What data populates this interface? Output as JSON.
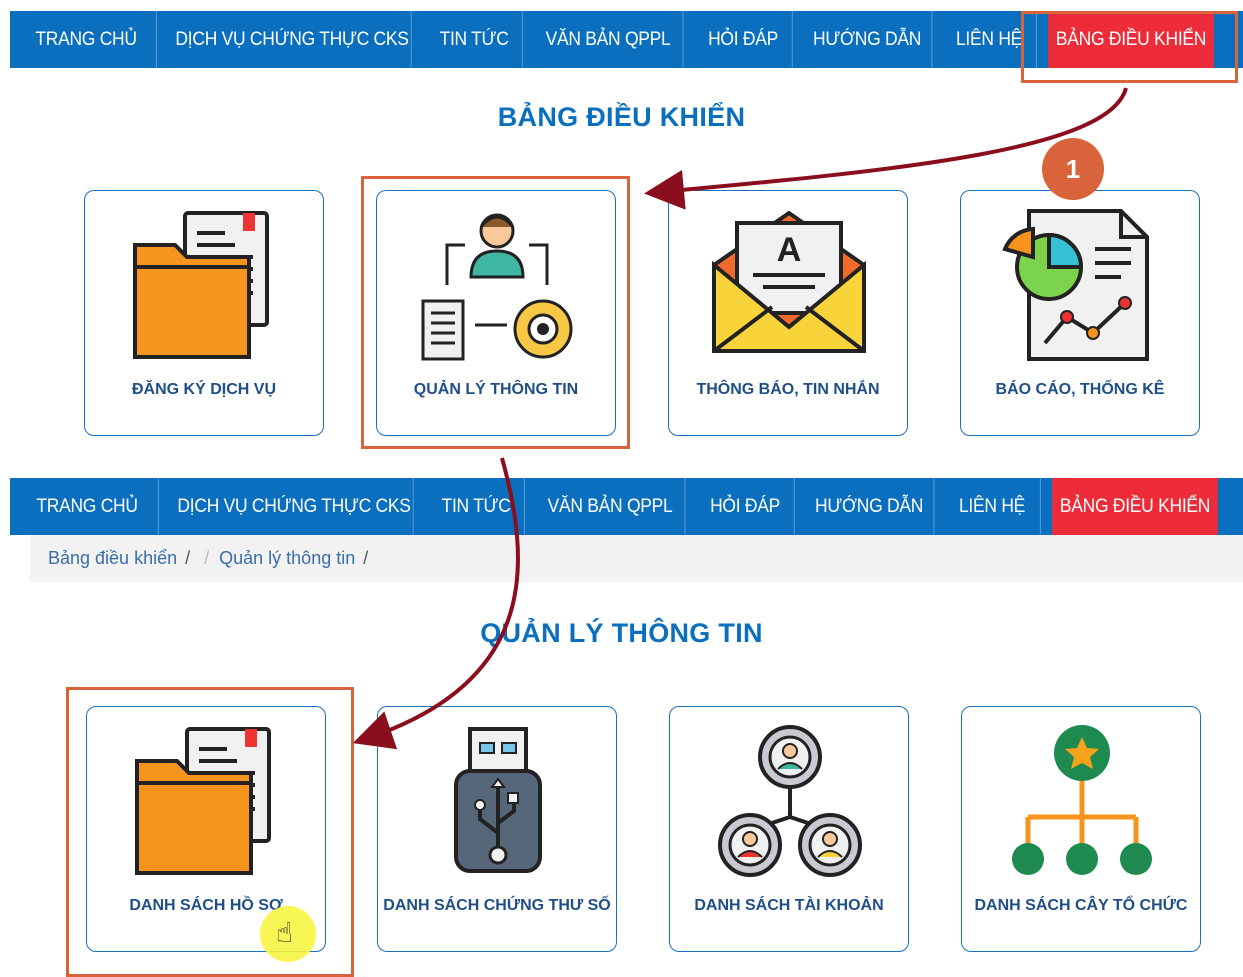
{
  "nav": {
    "items": [
      "TRANG CHỦ",
      "DỊCH VỤ CHỨNG THỰC CKS",
      "TIN TỨC",
      "VĂN BẢN QPPL",
      "HỎI ĐÁP",
      "HƯỚNG DẪN",
      "LIÊN HỆ",
      "BẢNG ĐIỀU KHIỂN"
    ],
    "active_index": 7
  },
  "dashboard": {
    "title": "BẢNG ĐIỀU KHIỂN",
    "cards": [
      {
        "label": "ĐĂNG KÝ DỊCH VỤ",
        "icon": "folder-document-icon"
      },
      {
        "label": "QUẢN LÝ THÔNG TIN",
        "icon": "user-gear-workflow-icon"
      },
      {
        "label": "THÔNG BÁO, TIN NHẮN",
        "icon": "envelope-letter-icon"
      },
      {
        "label": "BÁO CÁO, THỐNG KÊ",
        "icon": "report-chart-icon"
      }
    ]
  },
  "breadcrumb": {
    "items": [
      "Bảng điều khiển",
      "Quản lý thông tin"
    ],
    "separator": "/"
  },
  "info_management": {
    "title": "QUẢN LÝ THÔNG TIN",
    "cards": [
      {
        "label": "DANH SÁCH HỒ SƠ",
        "icon": "folder-document-icon"
      },
      {
        "label": "DANH SÁCH CHỨNG THƯ SỐ",
        "icon": "usb-token-icon"
      },
      {
        "label": "DANH SÁCH TÀI KHOẢN",
        "icon": "user-network-icon"
      },
      {
        "label": "DANH SÁCH CÂY TỔ CHỨC",
        "icon": "org-tree-icon"
      }
    ]
  },
  "annotation": {
    "step_number": "1",
    "highlight_color": "#d9633a",
    "arrow_color": "#8b0e1e"
  },
  "colors": {
    "nav_bg": "#0a6fbf",
    "nav_active": "#ee2b38",
    "title": "#0a6fbf",
    "card_border": "#1a6fc4",
    "card_label": "#1f4f86"
  }
}
